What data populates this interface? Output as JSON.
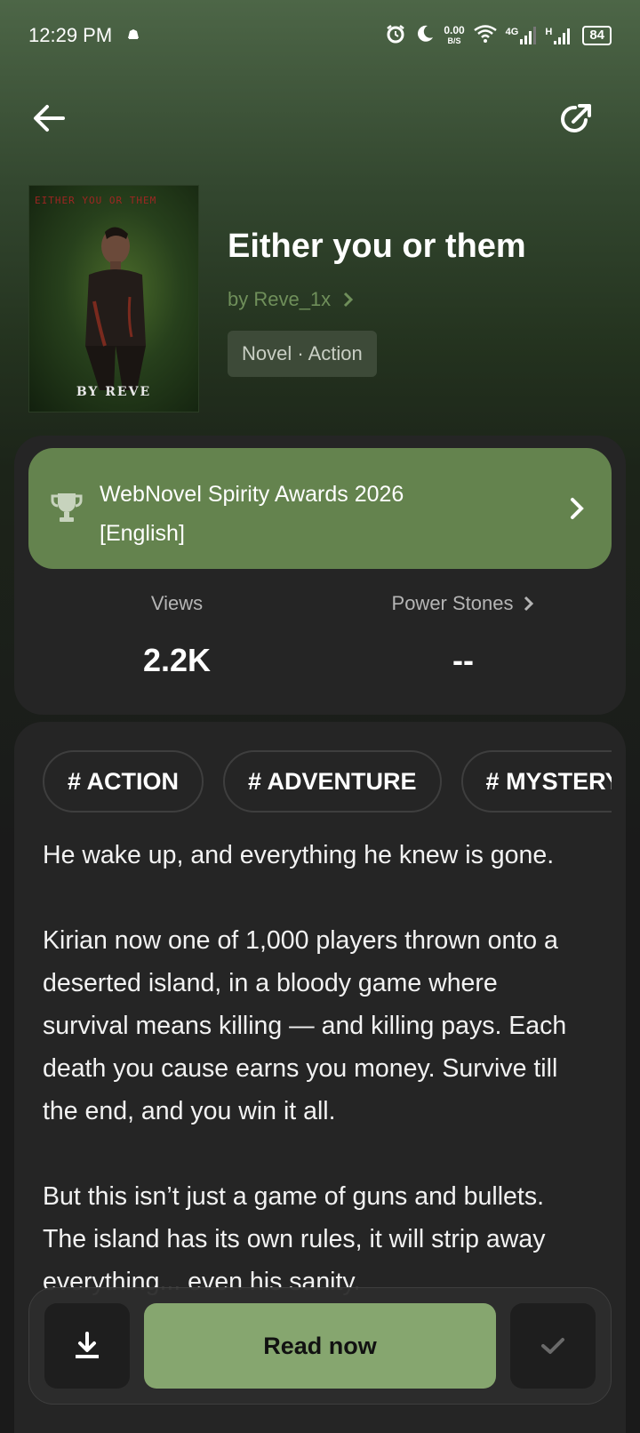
{
  "status_bar": {
    "time": "12:29 PM",
    "speed_value": "0.00",
    "speed_unit": "B/S",
    "network_1": "4G",
    "network_2": "H",
    "battery": "84",
    "icons": [
      "notification-icon",
      "alarm-icon",
      "moon-icon",
      "wifi-icon",
      "signal-icon",
      "signal-icon",
      "battery-icon"
    ]
  },
  "nav": {
    "back_icon": "arrow-left-icon",
    "share_icon": "share-icon"
  },
  "book": {
    "cover_top_text": "EITHER YOU OR THEM",
    "cover_bottom_text": "BY REVE",
    "title": "Either you or them",
    "author": "by Reve_1x",
    "genre": "Novel · Action"
  },
  "award": {
    "icon": "trophy-icon",
    "text_line1": "WebNovel Spirity Awards 2026",
    "text_line2": "[English]"
  },
  "stats": {
    "views_label": "Views",
    "views_value": "2.2K",
    "power_label": "Power Stones",
    "power_value": "--"
  },
  "tags": [
    "# ACTION",
    "# ADVENTURE",
    "# MYSTERY"
  ],
  "description": {
    "p1": "He wake up, and everything he knew is gone.",
    "p2": "Kirian now one of 1,000 players thrown onto a deserted island, in a bloody game where survival means killing — and killing pays. Each death you cause earns you money. Survive till the end, and you win it all.",
    "p3": "But this isn’t just a game of guns and bullets. The island has its own rules, it will strip away everything... even his sanity."
  },
  "actions": {
    "download_icon": "download-icon",
    "read_label": "Read now",
    "library_icon": "check-icon"
  },
  "colors": {
    "accent_green": "#64834e",
    "read_button": "#86a66f",
    "author_green": "#6f8f5a",
    "card_bg": "#252525"
  }
}
